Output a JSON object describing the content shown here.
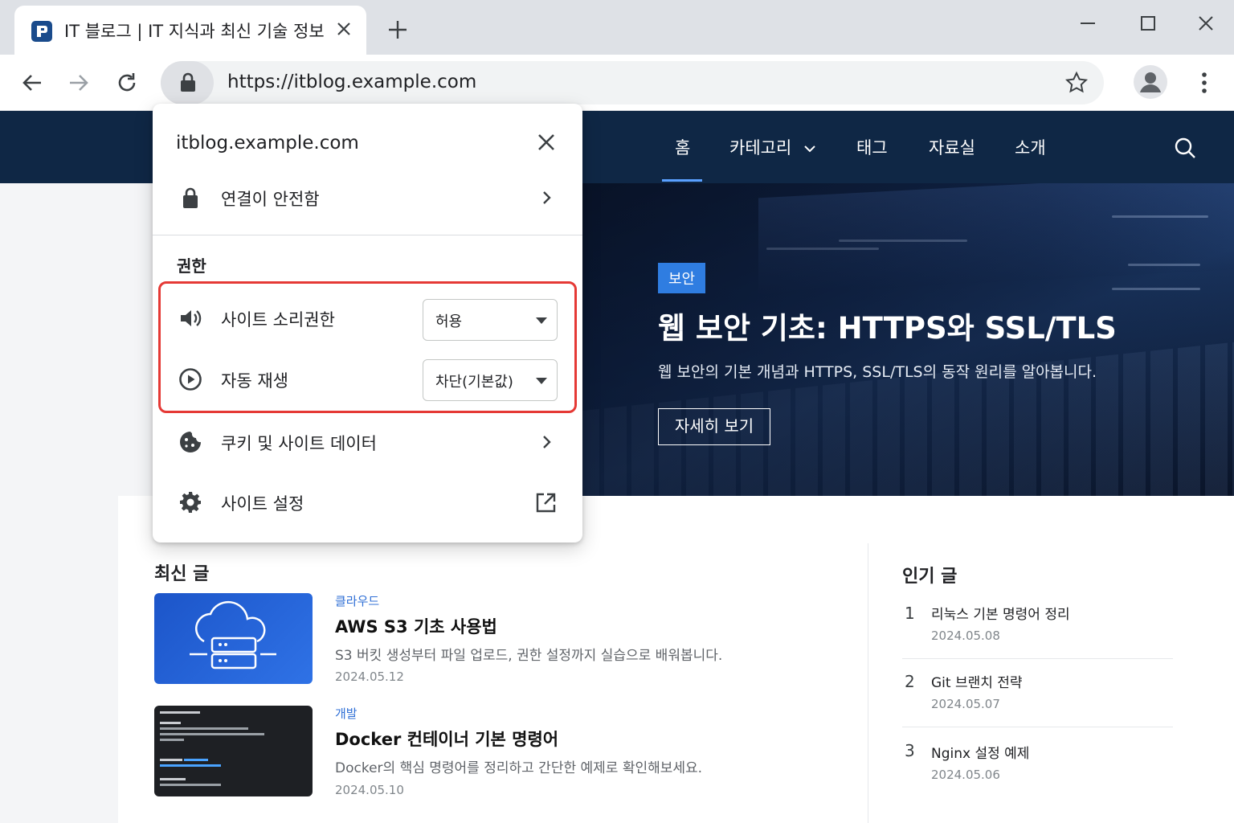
{
  "browser": {
    "tab_title": "IT 블로그 | IT 지식과 최신 기술 정보",
    "url": "https://itblog.example.com"
  },
  "site": {
    "nav": [
      {
        "label": "홈"
      },
      {
        "label": "카테고리"
      },
      {
        "label": "태그"
      },
      {
        "label": "자료실"
      },
      {
        "label": "소개"
      }
    ],
    "hero": {
      "badge": "보안",
      "title": "웹 보안 기초:  HTTPS와 SSL/TLS",
      "description": "웹 보안의 기본 개념과 HTTPS, SSL/TLS의 동작 원리를 알아봅니다.",
      "button": "자세히 보기"
    },
    "latest": {
      "title": "최신 글",
      "posts": [
        {
          "category": "클라우드",
          "title": "AWS S3 기초 사용법",
          "description": "S3 버킷 생성부터 파일 업로드, 권한 설정까지 실습으로 배워봅니다.",
          "date": "2024.05.12"
        },
        {
          "category": "개발",
          "title": "Docker 컨테이너 기본 명령어",
          "description": "Docker의 핵심 명령어를 정리하고 간단한 예제로 확인해보세요.",
          "date": "2024.05.10"
        }
      ]
    },
    "popular": {
      "title": "인기 글",
      "items": [
        {
          "rank": "1",
          "title": "리눅스 기본 명령어 정리",
          "date": "2024.05.08"
        },
        {
          "rank": "2",
          "title": "Git 브랜치 전략",
          "date": "2024.05.07"
        },
        {
          "rank": "3",
          "title": "Nginx 설정 예제",
          "date": "2024.05.06"
        }
      ]
    }
  },
  "popup": {
    "domain": "itblog.example.com",
    "connection": "연결이 안전함",
    "permissions_title": "권한",
    "permissions": [
      {
        "label": "사이트 소리권한",
        "value": "허용",
        "icon": "speaker-icon"
      },
      {
        "label": "자동 재생",
        "value": "차단(기본값)",
        "icon": "play-circle-icon"
      }
    ],
    "cookies": "쿠키 및 사이트 데이터",
    "site_settings": "사이트 설정"
  },
  "colors": {
    "site_header": "#0f2745",
    "accent": "#2f7de1",
    "highlight": "#e53935"
  }
}
